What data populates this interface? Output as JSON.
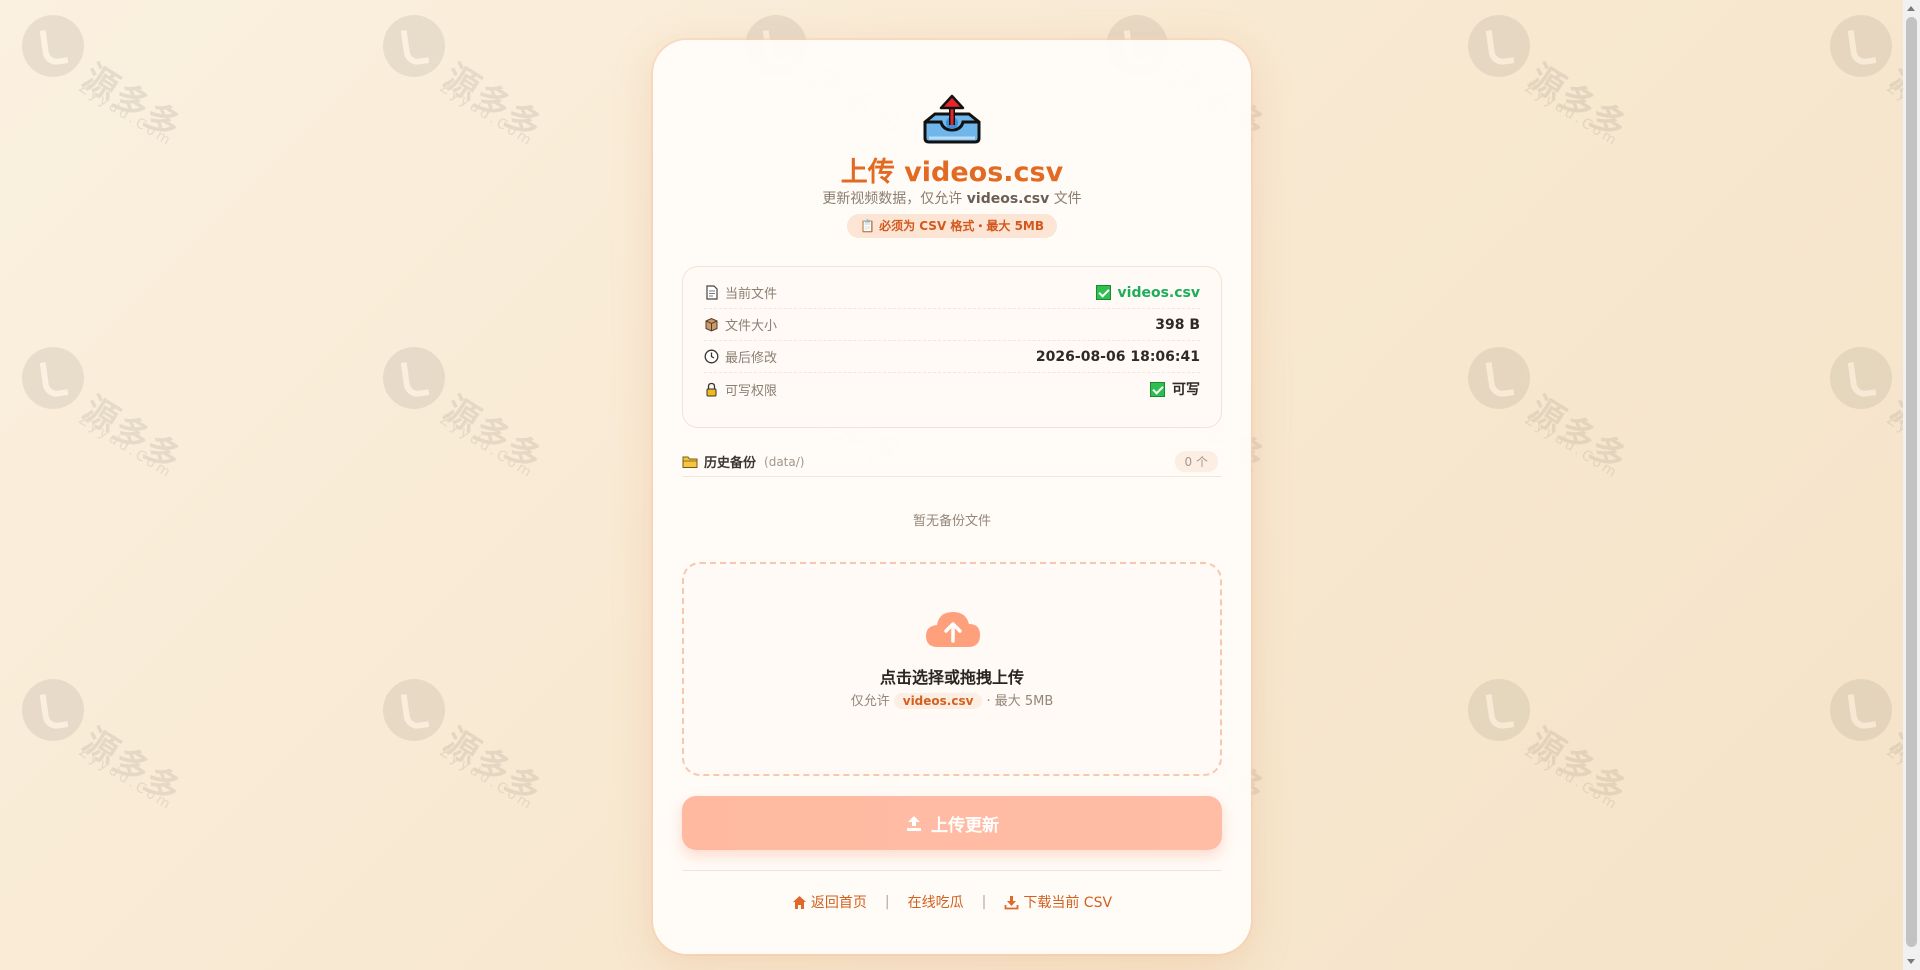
{
  "watermark": {
    "brand": "源多多",
    "domain": "Zyydd.Com"
  },
  "header": {
    "icon": "upload-tray-icon",
    "title": "上传 videos.csv",
    "subtitle_prefix": "更新视频数据，仅允许",
    "subtitle_file": "videos.csv",
    "subtitle_suffix": "文件",
    "requirement": "📋 必须为 CSV 格式・最大 5MB"
  },
  "info": {
    "rows": [
      {
        "icon": "document-icon",
        "label": "当前文件",
        "value": "videos.csv",
        "status": "ok"
      },
      {
        "icon": "box-icon",
        "label": "文件大小",
        "value": "398 B"
      },
      {
        "icon": "clock-icon",
        "label": "最后修改",
        "value": "2026-08-06 18:06:41"
      },
      {
        "icon": "lock-icon",
        "label": "可写权限",
        "value": "可写",
        "status": "ok"
      }
    ]
  },
  "backups": {
    "title": "历史备份",
    "path": "(data/)",
    "count": "0 个",
    "empty": "暂无备份文件"
  },
  "dropzone": {
    "title": "点击选择或拖拽上传",
    "hint_prefix": "仅允许",
    "hint_file": "videos.csv",
    "hint_suffix": "· 最大 5MB"
  },
  "upload_button": {
    "label": "上传更新"
  },
  "footer": {
    "home": "返回首页",
    "gossip": "在线吃瓜",
    "download": "下载当前 CSV",
    "separator": "|"
  },
  "colors": {
    "accent": "#e26a23",
    "success": "#1cae5a",
    "button": "#ffb9a1"
  }
}
